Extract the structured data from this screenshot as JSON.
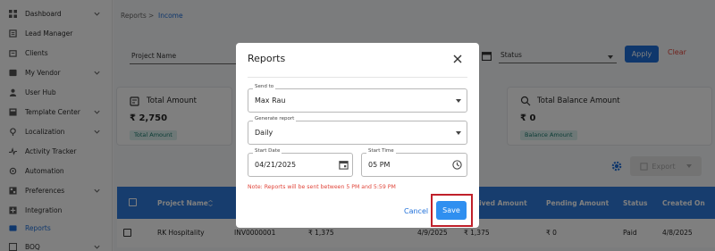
{
  "sidebar": {
    "items": [
      {
        "label": "Dashboard",
        "icon": "dashboard-icon",
        "chevron": true
      },
      {
        "label": "Lead Manager",
        "icon": "lead-manager-icon",
        "chevron": false
      },
      {
        "label": "Clients",
        "icon": "clients-icon",
        "chevron": false
      },
      {
        "label": "My Vendor",
        "icon": "vendor-icon",
        "chevron": true
      },
      {
        "label": "User Hub",
        "icon": "user-icon",
        "chevron": false
      },
      {
        "label": "Template Center",
        "icon": "template-icon",
        "chevron": true
      },
      {
        "label": "Localization",
        "icon": "localization-icon",
        "chevron": true
      },
      {
        "label": "Activity Tracker",
        "icon": "activity-icon",
        "chevron": false
      },
      {
        "label": "Automation",
        "icon": "automation-icon",
        "chevron": false
      },
      {
        "label": "Preferences",
        "icon": "preferences-icon",
        "chevron": true
      },
      {
        "label": "Integration",
        "icon": "integration-icon",
        "chevron": false
      },
      {
        "label": "Reports",
        "icon": "reports-icon",
        "chevron": false,
        "active": true
      },
      {
        "label": "BOQ",
        "icon": "boq-icon",
        "chevron": true
      }
    ]
  },
  "breadcrumb": {
    "root": "Reports",
    "separator": ">",
    "current": "Income"
  },
  "filters": {
    "project_name_label": "Project Name",
    "status_label": "Status",
    "apply_label": "Apply",
    "clear_label": "Clear"
  },
  "cards": [
    {
      "title": "Total Amount",
      "value": "₹ 2,750",
      "badge": "Total Amount"
    },
    {
      "title": "Total Balance Amount",
      "value": "₹ 0",
      "badge": "Balance Amount"
    }
  ],
  "toolbar": {
    "export_label": "Export"
  },
  "table": {
    "headers": {
      "project_name": "Project Name",
      "received": "eived Amount",
      "pending": "Pending Amount",
      "status": "Status",
      "created": "Created On"
    },
    "rows": [
      {
        "project_name": "RK Hospitality",
        "invoice": "INV0000001",
        "amount": "₹ 1,375",
        "date": "4/9/2025",
        "received": "₹ 1,375",
        "pending": "₹ 0",
        "status": "Paid",
        "created": "4/8/2025"
      }
    ]
  },
  "modal": {
    "title": "Reports",
    "send_to": {
      "label": "Send to",
      "value": "Max Rau"
    },
    "generate_report": {
      "label": "Generate report",
      "value": "Daily"
    },
    "start_date": {
      "label": "Start Date",
      "value": "04/21/2025"
    },
    "start_time": {
      "label": "Start Time",
      "value": "05 PM"
    },
    "note": "Note: Reports will be sent between 5 PM and 5:59 PM",
    "cancel_label": "Cancel",
    "save_label": "Save"
  },
  "colors": {
    "accent": "#1e6fd9",
    "table_header": "#2e7bdc",
    "danger": "#e0453a",
    "highlight": "#c0202b",
    "badge_bg": "#ddf0ee",
    "badge_text": "#17796b"
  }
}
